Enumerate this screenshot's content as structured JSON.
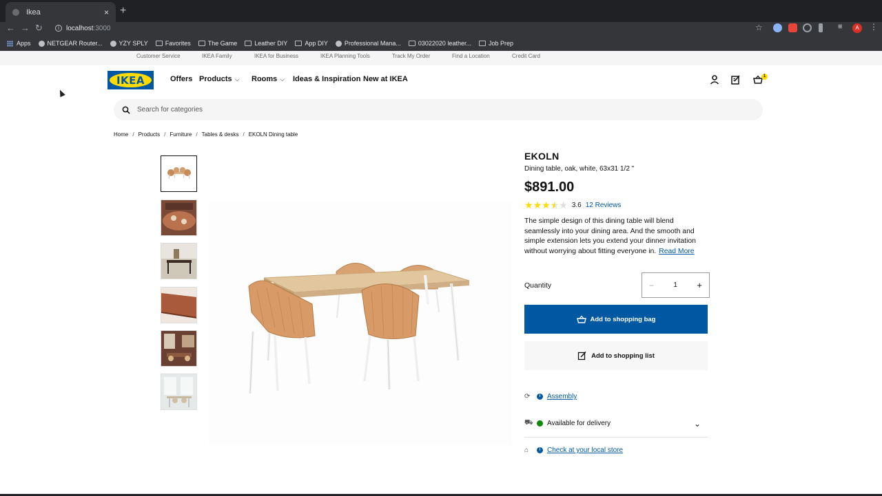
{
  "browser": {
    "tab_title": "Ikea",
    "tab_close": "×",
    "new_tab": "+",
    "url_host": "localhost",
    "url_port": ":3000",
    "avatar_initial": "A",
    "bookmarks": [
      {
        "label": "Apps",
        "icon": "apps-grid-icon"
      },
      {
        "label": "NETGEAR Router...",
        "icon": "globe-icon"
      },
      {
        "label": "YZY SPLY",
        "icon": "yzy-icon"
      },
      {
        "label": "Favorites",
        "icon": "folder-icon"
      },
      {
        "label": "The Game",
        "icon": "folder-icon"
      },
      {
        "label": "Leather DIY",
        "icon": "folder-icon"
      },
      {
        "label": "App DIY",
        "icon": "folder-icon"
      },
      {
        "label": "Professional Mana...",
        "icon": "f-icon"
      },
      {
        "label": "03022020 leather...",
        "icon": "folder-icon"
      },
      {
        "label": "Job Prep",
        "icon": "folder-icon"
      }
    ]
  },
  "utility_links": [
    "Customer Service",
    "IKEA Family",
    "IKEA for Business",
    "IKEA Planning Tools",
    "Track My Order",
    "Find a Location",
    "Credit Card"
  ],
  "header": {
    "logo_text": "IKEA",
    "nav": [
      "Offers",
      "Products",
      "Rooms",
      "Ideas & Inspiration",
      "New at IKEA"
    ],
    "cart_count": "1"
  },
  "search": {
    "placeholder": "Search for categories"
  },
  "breadcrumb": [
    "Home",
    "Products",
    "Furniture",
    "Tables & desks",
    "EKOLN Dining table"
  ],
  "product": {
    "name": "EKOLN",
    "description": "Dining table, oak, white, 63x31 1/2 \"",
    "price": "$891.00",
    "rating": 3.6,
    "rating_text": "3.6",
    "reviews": "12 Reviews",
    "blurb": "The simple design of this dining table will blend seamlessly into your dining area. And the smooth and simple extension lets you extend your dinner invitation without worrying about fitting everyone in.",
    "read_more": "Read More",
    "quantity_label": "Quantity",
    "quantity": "1",
    "add_to_bag": "Add to shopping bag",
    "add_to_list": "Add to shopping list",
    "assembly": "Assembly",
    "delivery": "Available for delivery",
    "store_check": "Check at your local store"
  },
  "colors": {
    "ikea_blue": "#0058a3",
    "ikea_yellow": "#ffdb00",
    "in_stock_green": "#0a8a00"
  }
}
